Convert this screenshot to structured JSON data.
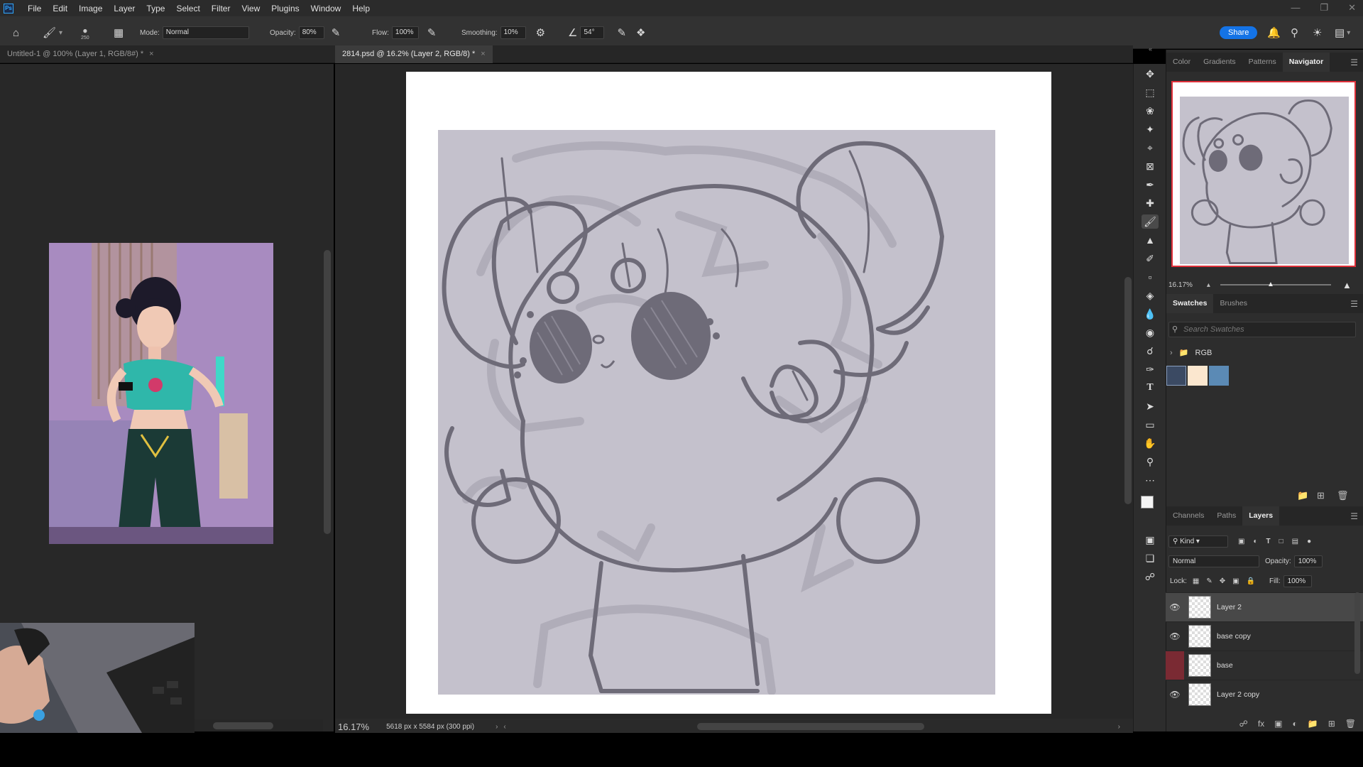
{
  "app": {
    "logo": "Ps"
  },
  "menu": [
    "File",
    "Edit",
    "Image",
    "Layer",
    "Type",
    "Select",
    "Filter",
    "View",
    "Plugins",
    "Window",
    "Help"
  ],
  "options": {
    "brush_size": "250",
    "mode_label": "Mode:",
    "mode_value": "Normal",
    "opacity_label": "Opacity:",
    "opacity_value": "80%",
    "flow_label": "Flow:",
    "flow_value": "100%",
    "smoothing_label": "Smoothing:",
    "smoothing_value": "10%",
    "angle_value": "54°",
    "share_label": "Share"
  },
  "tabs": [
    {
      "label": "Untitled-1 @ 100% (Layer 1, RGB/8#) *"
    },
    {
      "label": "2814.psd @ 16.2% (Layer 2, RGB/8) *"
    }
  ],
  "status": {
    "zoom": "16.17%",
    "doc_info": "5618 px x 5584 px (300 ppi)"
  },
  "top_panel": {
    "tabs": [
      "Color",
      "Gradients",
      "Patterns",
      "Navigator"
    ],
    "active_tab": "Navigator",
    "zoom": "16.17%"
  },
  "swatches_panel": {
    "tabs": [
      "Swatches",
      "Brushes"
    ],
    "search_placeholder": "Search Swatches",
    "group_name": "RGB",
    "colors": [
      "#3b4a63",
      "#fbe7cf",
      "#5b8ab5"
    ]
  },
  "layers_panel": {
    "tabs": [
      "Channels",
      "Paths",
      "Layers"
    ],
    "filter_label": "Kind",
    "blend_mode": "Normal",
    "opacity_label": "Opacity:",
    "opacity_value": "100%",
    "lock_label": "Lock:",
    "fill_label": "Fill:",
    "fill_value": "100%",
    "layers": [
      {
        "name": "Layer 2",
        "selected": true,
        "visible": true
      },
      {
        "name": "base copy",
        "selected": false,
        "visible": true
      },
      {
        "name": "base",
        "selected": false,
        "visible": false
      },
      {
        "name": "Layer 2 copy",
        "selected": false,
        "visible": true
      }
    ]
  },
  "colors": {
    "accent": "#1473e6",
    "navigator_frame": "#e0303a",
    "canvas_bg": "#c4c1cc",
    "sketch": "#6e6b78"
  }
}
